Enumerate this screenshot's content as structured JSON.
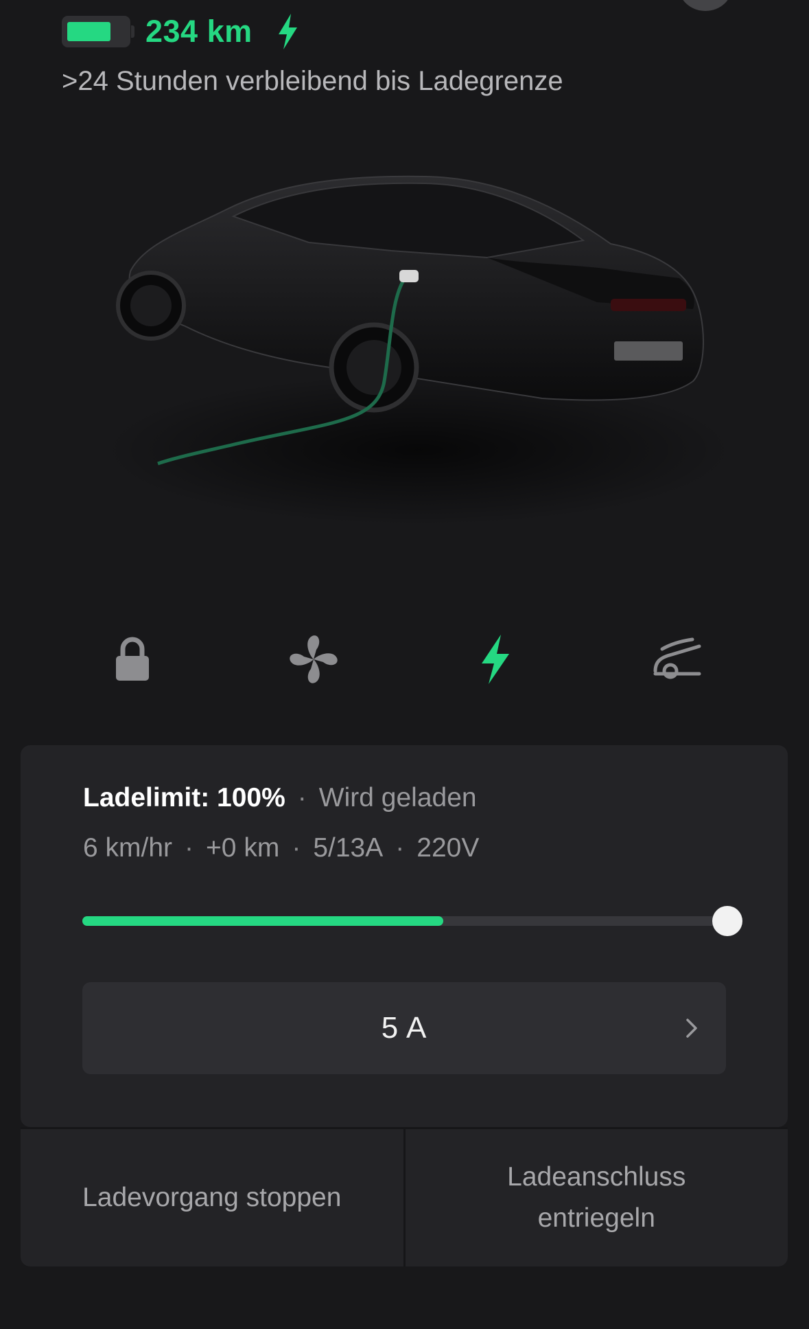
{
  "header": {
    "range": "234 km",
    "battery_level": 0.75,
    "remaining": ">24 Stunden verbleibend bis Ladegrenze"
  },
  "nav_icons": [
    "lock-icon",
    "fan-icon",
    "bolt-icon",
    "car-trunk-icon"
  ],
  "charging": {
    "limit_label": "Ladelimit: 100%",
    "state": "Wird geladen",
    "rate": "6 km/hr",
    "added": "+0 km",
    "current": "5/13A",
    "voltage": "220V",
    "charge_fraction": 0.56,
    "limit_fraction": 1.0,
    "amp_value": "5 A"
  },
  "actions": {
    "stop": "Ladevorgang stoppen",
    "unlock": "Ladeanschluss entriegeln"
  },
  "colors": {
    "accent": "#25d882",
    "background": "#18181a",
    "panel": "#232326"
  }
}
